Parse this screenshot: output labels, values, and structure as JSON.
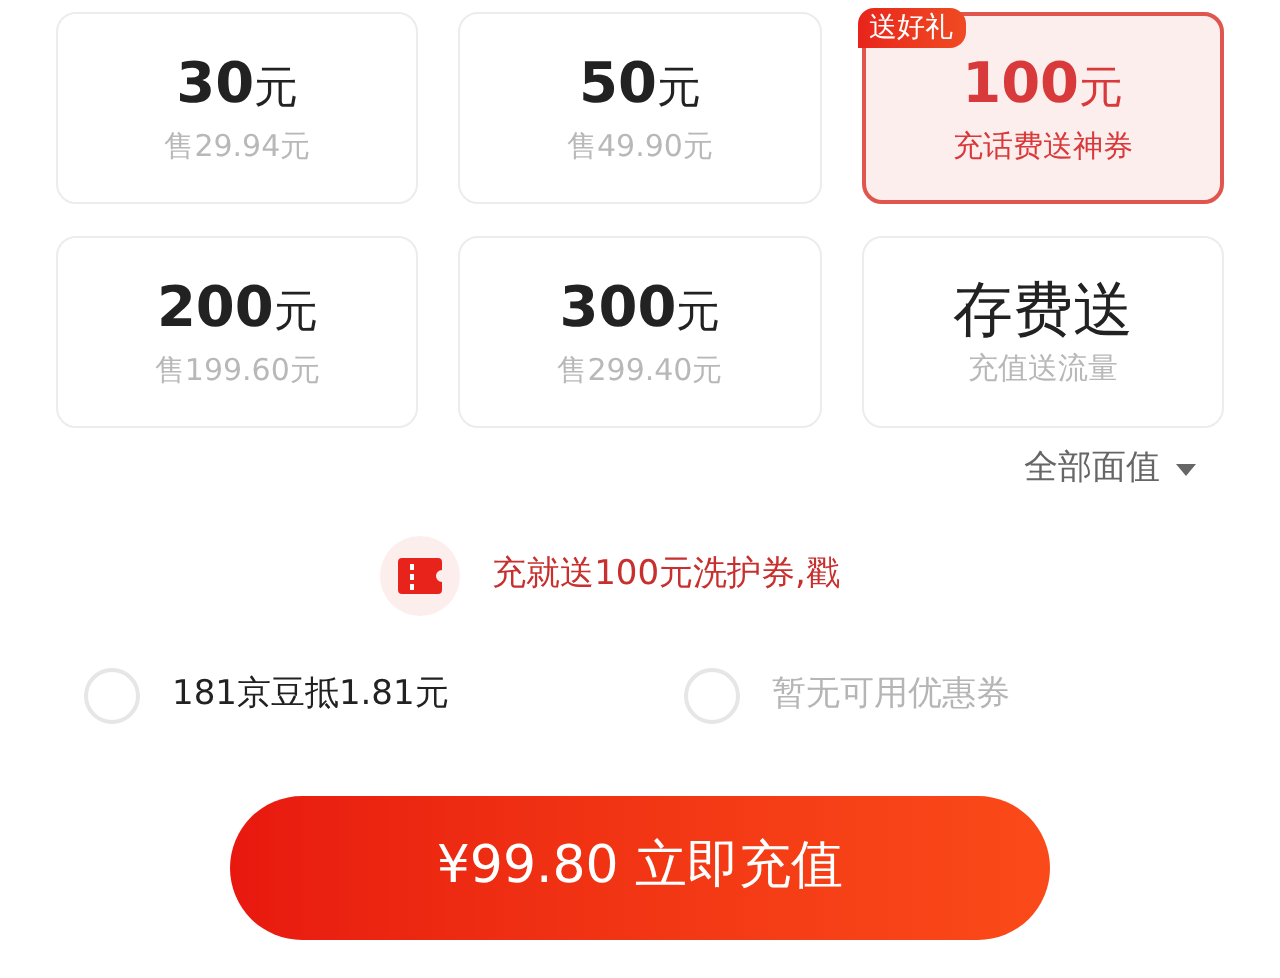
{
  "cards": [
    {
      "kind": "denomination",
      "amount": "30",
      "unit": "元",
      "subtitle": "售29.94元",
      "selected": false
    },
    {
      "kind": "denomination",
      "amount": "50",
      "unit": "元",
      "subtitle": "售49.90元",
      "selected": false
    },
    {
      "kind": "denomination",
      "amount": "100",
      "unit": "元",
      "subtitle": "充话费送神券",
      "selected": true,
      "badge": "送好礼"
    },
    {
      "kind": "denomination",
      "amount": "200",
      "unit": "元",
      "subtitle": "售199.60元",
      "selected": false
    },
    {
      "kind": "denomination",
      "amount": "300",
      "unit": "元",
      "subtitle": "售299.40元",
      "selected": false
    },
    {
      "kind": "promo",
      "title": "存费送",
      "subtitle": "充值送流量",
      "selected": false
    }
  ],
  "filter": {
    "label": "全部面值"
  },
  "promo_banner": {
    "text": "充就送100元洗护券,戳"
  },
  "discounts": [
    {
      "label": "181京豆抵1.81元",
      "checked": false,
      "disabled": false
    },
    {
      "label": "暂无可用优惠券",
      "checked": false,
      "disabled": true
    }
  ],
  "pay_button": {
    "label": "¥99.80 立即充值"
  }
}
